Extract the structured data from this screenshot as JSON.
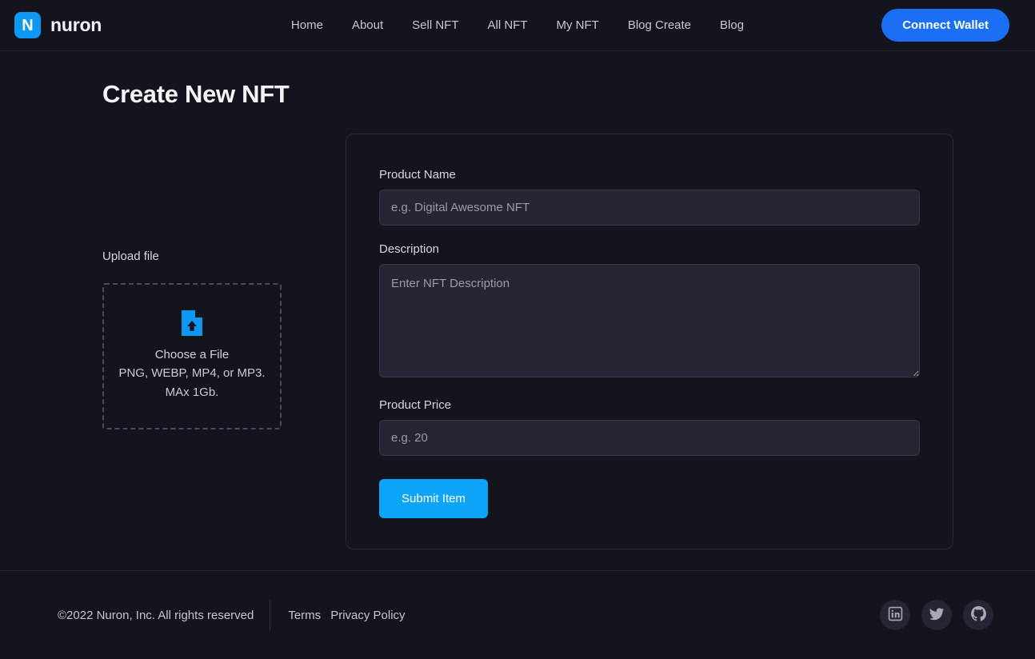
{
  "header": {
    "brand_mark": "N",
    "brand_name": "nuron",
    "nav_items": [
      {
        "label": "Home"
      },
      {
        "label": "About"
      },
      {
        "label": "Sell NFT"
      },
      {
        "label": "All NFT"
      },
      {
        "label": "My NFT"
      },
      {
        "label": "Blog Create"
      },
      {
        "label": "Blog"
      }
    ],
    "connect_wallet_label": "Connect Wallet"
  },
  "main": {
    "page_title": "Create New NFT",
    "upload": {
      "label": "Upload file",
      "icon": "file-upload-icon",
      "primary_text": "Choose a File",
      "secondary_text": "PNG, WEBP, MP4, or MP3. MAx 1Gb."
    },
    "form": {
      "product_name": {
        "label": "Product Name",
        "placeholder": "e.g. Digital Awesome NFT",
        "value": ""
      },
      "description": {
        "label": "Description",
        "placeholder": "Enter NFT Description",
        "value": ""
      },
      "product_price": {
        "label": "Product Price",
        "placeholder": "e.g. 20",
        "value": ""
      },
      "submit_label": "Submit Item"
    }
  },
  "footer": {
    "copyright": "©2022 Nuron, Inc. All rights reserved",
    "links": [
      {
        "label": "Terms"
      },
      {
        "label": "Privacy Policy"
      }
    ],
    "socials": [
      {
        "name": "linkedin-icon"
      },
      {
        "name": "twitter-icon"
      },
      {
        "name": "github-icon"
      }
    ]
  },
  "colors": {
    "page_background": "#14141f",
    "accent_blue": "#1a6ff5",
    "accent_cyan": "#0ea5f9",
    "logo_blue": "#0d99f2",
    "input_background": "#272533"
  }
}
